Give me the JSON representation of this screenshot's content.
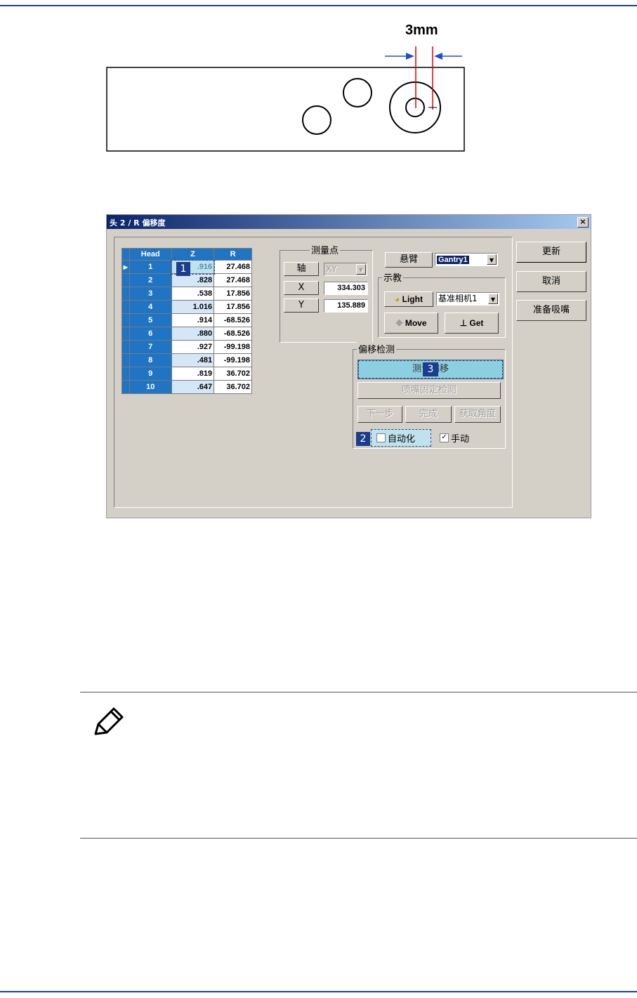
{
  "diagram": {
    "dimension_label": "3mm"
  },
  "dialog": {
    "title": "头 2 / R 偏移度",
    "close_label": "×",
    "buttons": {
      "refresh": "更新",
      "cancel": "取消",
      "prepare_nozzle": "准备吸嘴"
    },
    "grid": {
      "columns": [
        "Head",
        "Z",
        "R"
      ],
      "rows": [
        {
          "head": "1",
          "z": ".916",
          "r": "27.468"
        },
        {
          "head": "2",
          "z": ".828",
          "r": "27.468"
        },
        {
          "head": "3",
          "z": ".538",
          "r": "17.856"
        },
        {
          "head": "4",
          "z": "1.016",
          "r": "17.856"
        },
        {
          "head": "5",
          "z": ".914",
          "r": "-68.526"
        },
        {
          "head": "6",
          "z": ".880",
          "r": "-68.526"
        },
        {
          "head": "7",
          "z": ".927",
          "r": "-99.198"
        },
        {
          "head": "8",
          "z": ".481",
          "r": "-99.198"
        },
        {
          "head": "9",
          "z": ".819",
          "r": "36.702"
        },
        {
          "head": "10",
          "z": ".647",
          "r": "36.702"
        }
      ]
    },
    "measure_point": {
      "group_label": "测量点",
      "axis_label": "轴",
      "axis_value": "XY",
      "x_label": "X",
      "x_value": "334.303",
      "y_label": "Y",
      "y_value": "135.889"
    },
    "gantry": {
      "label": "悬臂",
      "value": "Gantry1"
    },
    "teach": {
      "group_label": "示教",
      "light_button": "Light",
      "camera_value": "基准相机1",
      "move_button": "Move",
      "get_button": "Get"
    },
    "offset_detect": {
      "group_label": "偏移检测",
      "measure_offset_button": "测试偏移",
      "nozzle_fixed_button": "喷嘴固定检测",
      "next_button": "下一步",
      "finish_button": "完成",
      "get_angle_button": "获取角度",
      "auto_label": "自动化",
      "auto_checked": false,
      "manual_label": "手动",
      "manual_checked": true
    },
    "callouts": {
      "one": "1",
      "two": "2",
      "three": "3"
    }
  }
}
